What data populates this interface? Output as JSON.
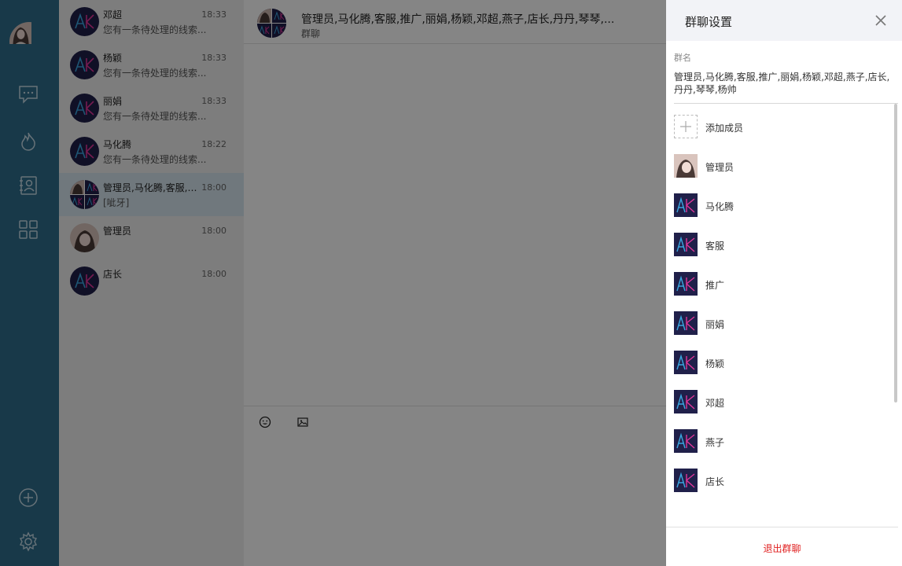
{
  "colors": {
    "rail": "#2e6e8c",
    "active_row": "#d7e6ef",
    "exit": "#e02020",
    "ak_bg": "#20204a"
  },
  "nav": {
    "icons": [
      "chat-icon",
      "hot-icon",
      "contacts-icon",
      "apps-icon",
      "add-circle-icon",
      "settings-icon"
    ]
  },
  "conversations": [
    {
      "name": "邓超",
      "time": "18:33",
      "message": "您有一条待处理的线索..."
    },
    {
      "name": "杨颖",
      "time": "18:33",
      "message": "您有一条待处理的线索..."
    },
    {
      "name": "丽娟",
      "time": "18:33",
      "message": "您有一条待处理的线索..."
    },
    {
      "name": "马化腾",
      "time": "18:22",
      "message": "您有一条待处理的线索..."
    },
    {
      "name": "管理员,马化腾,客服,推...",
      "time": "18:00",
      "message": "[呲牙]"
    },
    {
      "name": "管理员",
      "time": "18:00",
      "message": ""
    },
    {
      "name": "店长",
      "time": "18:00",
      "message": ""
    }
  ],
  "chat": {
    "title": "管理员,马化腾,客服,推广,丽娟,杨颖,邓超,燕子,店长,丹丹,琴琴,...",
    "subtitle": "群聊"
  },
  "drawer": {
    "title": "群聊设置",
    "group_name_label": "群名",
    "group_name": "管理员,马化腾,客服,推广,丽娟,杨颖,邓超,燕子,店长,丹丹,琴琴,杨帅",
    "add_member": "添加成员",
    "members": [
      "管理员",
      "马化腾",
      "客服",
      "推广",
      "丽娟",
      "杨颖",
      "邓超",
      "燕子",
      "店长"
    ],
    "exit_label": "退出群聊"
  }
}
